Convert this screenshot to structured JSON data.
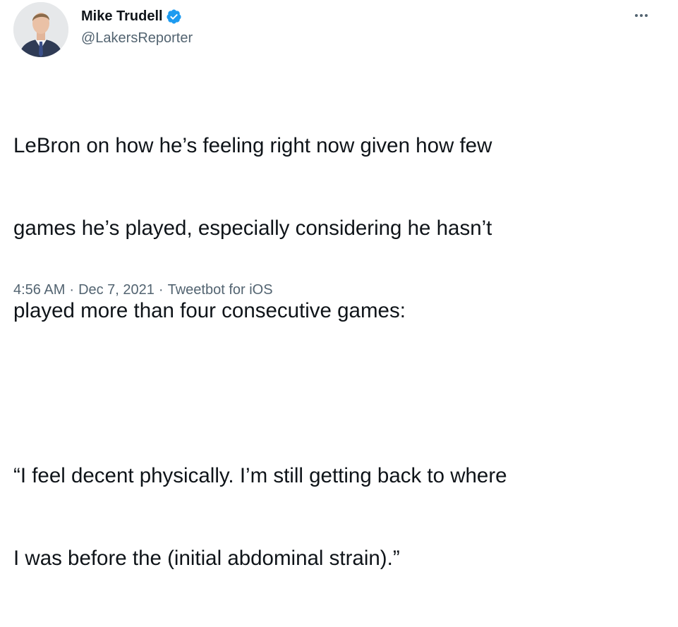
{
  "author": {
    "display_name": "Mike Trudell",
    "handle": "@LakersReporter",
    "verified": true
  },
  "tweet": {
    "lines": [
      "LeBron on how he’s feeling right now given how few",
      "games he’s played, especially considering he hasn’t",
      "played more than four consecutive games:",
      "",
      "“I feel decent physically. I’m still getting back to where",
      "I was before the (initial abdominal strain).”"
    ]
  },
  "meta": {
    "time": "4:56 AM",
    "separator": "·",
    "date": "Dec 7, 2021",
    "source": "Tweetbot for iOS"
  },
  "colors": {
    "text": "#0f1419",
    "secondary": "#536471",
    "verified": "#1d9bf0"
  },
  "icons": {
    "verified": "verified-badge-icon",
    "more": "more-options-icon"
  }
}
